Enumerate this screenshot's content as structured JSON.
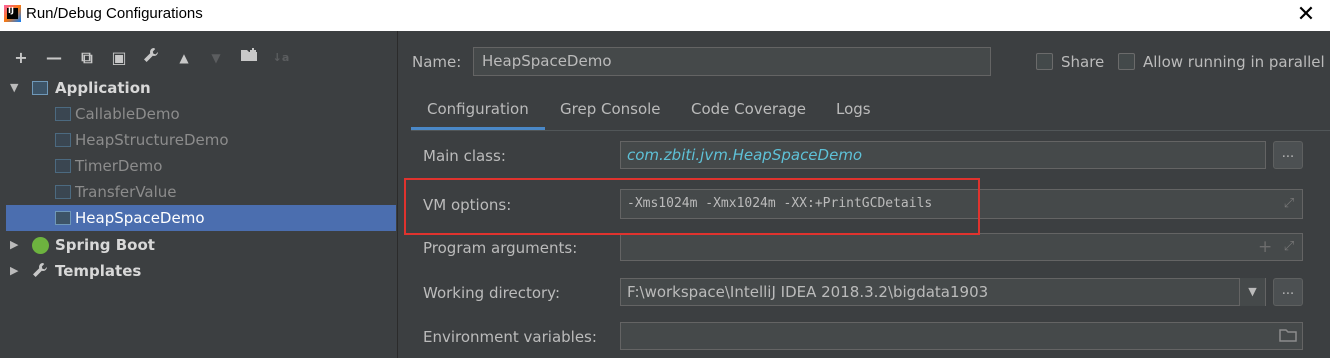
{
  "window": {
    "title": "Run/Debug Configurations",
    "close_glyph": "✕"
  },
  "toolbar": {
    "add": "+",
    "remove": "—",
    "copy": "⧉",
    "save": "▣",
    "edit": "🔧",
    "up": "▲",
    "down": "▼",
    "folder": "📁",
    "sort": "↓a"
  },
  "tree": {
    "application": {
      "label": "Application",
      "arrow": "▼"
    },
    "children": [
      {
        "label": "CallableDemo"
      },
      {
        "label": "HeapStructureDemo"
      },
      {
        "label": "TimerDemo"
      },
      {
        "label": "TransferValue"
      },
      {
        "label": "HeapSpaceDemo",
        "selected": true
      }
    ],
    "spring_boot": {
      "label": "Spring Boot",
      "arrow": "▶"
    },
    "templates": {
      "label": "Templates",
      "arrow": "▶"
    }
  },
  "name_field": {
    "label": "Name:",
    "value": "HeapSpaceDemo"
  },
  "options": {
    "share_label": "Share",
    "allow_parallel_label": "Allow running in parallel"
  },
  "tabs": [
    {
      "label": "Configuration",
      "active": true
    },
    {
      "label": "Grep Console"
    },
    {
      "label": "Code Coverage"
    },
    {
      "label": "Logs"
    }
  ],
  "form": {
    "main_class": {
      "label": "Main class:",
      "value": "com.zbiti.jvm.HeapSpaceDemo",
      "button": "..."
    },
    "vm_options": {
      "label": "VM options:",
      "value": "-Xms1024m  -Xmx1024m -XX:+PrintGCDetails"
    },
    "program_arguments": {
      "label": "Program arguments:",
      "value": ""
    },
    "working_directory": {
      "label": "Working directory:",
      "value": "F:\\workspace\\IntelliJ IDEA 2018.3.2\\bigdata1903",
      "button": "..."
    },
    "environment_variables": {
      "label": "Environment variables:",
      "value": ""
    }
  },
  "colors": {
    "accent": "#4b6eaf",
    "highlight": "#e0332e",
    "main_class_text": "#5ec1d7"
  }
}
